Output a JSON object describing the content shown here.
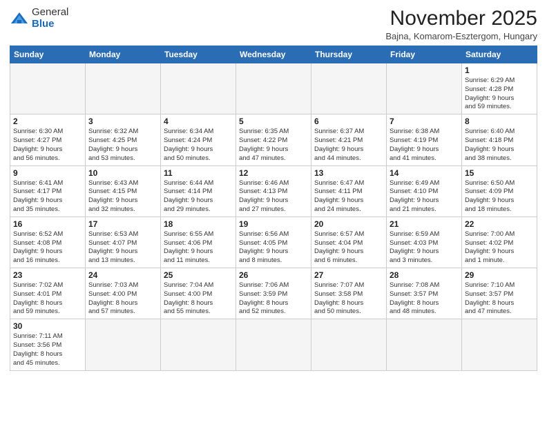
{
  "logo": {
    "general": "General",
    "blue": "Blue"
  },
  "header": {
    "month_title": "November 2025",
    "subtitle": "Bajna, Komarom-Esztergom, Hungary"
  },
  "weekdays": [
    "Sunday",
    "Monday",
    "Tuesday",
    "Wednesday",
    "Thursday",
    "Friday",
    "Saturday"
  ],
  "weeks": [
    [
      {
        "day": "",
        "info": ""
      },
      {
        "day": "",
        "info": ""
      },
      {
        "day": "",
        "info": ""
      },
      {
        "day": "",
        "info": ""
      },
      {
        "day": "",
        "info": ""
      },
      {
        "day": "",
        "info": ""
      },
      {
        "day": "1",
        "info": "Sunrise: 6:29 AM\nSunset: 4:28 PM\nDaylight: 9 hours\nand 59 minutes."
      }
    ],
    [
      {
        "day": "2",
        "info": "Sunrise: 6:30 AM\nSunset: 4:27 PM\nDaylight: 9 hours\nand 56 minutes."
      },
      {
        "day": "3",
        "info": "Sunrise: 6:32 AM\nSunset: 4:25 PM\nDaylight: 9 hours\nand 53 minutes."
      },
      {
        "day": "4",
        "info": "Sunrise: 6:34 AM\nSunset: 4:24 PM\nDaylight: 9 hours\nand 50 minutes."
      },
      {
        "day": "5",
        "info": "Sunrise: 6:35 AM\nSunset: 4:22 PM\nDaylight: 9 hours\nand 47 minutes."
      },
      {
        "day": "6",
        "info": "Sunrise: 6:37 AM\nSunset: 4:21 PM\nDaylight: 9 hours\nand 44 minutes."
      },
      {
        "day": "7",
        "info": "Sunrise: 6:38 AM\nSunset: 4:19 PM\nDaylight: 9 hours\nand 41 minutes."
      },
      {
        "day": "8",
        "info": "Sunrise: 6:40 AM\nSunset: 4:18 PM\nDaylight: 9 hours\nand 38 minutes."
      }
    ],
    [
      {
        "day": "9",
        "info": "Sunrise: 6:41 AM\nSunset: 4:17 PM\nDaylight: 9 hours\nand 35 minutes."
      },
      {
        "day": "10",
        "info": "Sunrise: 6:43 AM\nSunset: 4:15 PM\nDaylight: 9 hours\nand 32 minutes."
      },
      {
        "day": "11",
        "info": "Sunrise: 6:44 AM\nSunset: 4:14 PM\nDaylight: 9 hours\nand 29 minutes."
      },
      {
        "day": "12",
        "info": "Sunrise: 6:46 AM\nSunset: 4:13 PM\nDaylight: 9 hours\nand 27 minutes."
      },
      {
        "day": "13",
        "info": "Sunrise: 6:47 AM\nSunset: 4:11 PM\nDaylight: 9 hours\nand 24 minutes."
      },
      {
        "day": "14",
        "info": "Sunrise: 6:49 AM\nSunset: 4:10 PM\nDaylight: 9 hours\nand 21 minutes."
      },
      {
        "day": "15",
        "info": "Sunrise: 6:50 AM\nSunset: 4:09 PM\nDaylight: 9 hours\nand 18 minutes."
      }
    ],
    [
      {
        "day": "16",
        "info": "Sunrise: 6:52 AM\nSunset: 4:08 PM\nDaylight: 9 hours\nand 16 minutes."
      },
      {
        "day": "17",
        "info": "Sunrise: 6:53 AM\nSunset: 4:07 PM\nDaylight: 9 hours\nand 13 minutes."
      },
      {
        "day": "18",
        "info": "Sunrise: 6:55 AM\nSunset: 4:06 PM\nDaylight: 9 hours\nand 11 minutes."
      },
      {
        "day": "19",
        "info": "Sunrise: 6:56 AM\nSunset: 4:05 PM\nDaylight: 9 hours\nand 8 minutes."
      },
      {
        "day": "20",
        "info": "Sunrise: 6:57 AM\nSunset: 4:04 PM\nDaylight: 9 hours\nand 6 minutes."
      },
      {
        "day": "21",
        "info": "Sunrise: 6:59 AM\nSunset: 4:03 PM\nDaylight: 9 hours\nand 3 minutes."
      },
      {
        "day": "22",
        "info": "Sunrise: 7:00 AM\nSunset: 4:02 PM\nDaylight: 9 hours\nand 1 minute."
      }
    ],
    [
      {
        "day": "23",
        "info": "Sunrise: 7:02 AM\nSunset: 4:01 PM\nDaylight: 8 hours\nand 59 minutes."
      },
      {
        "day": "24",
        "info": "Sunrise: 7:03 AM\nSunset: 4:00 PM\nDaylight: 8 hours\nand 57 minutes."
      },
      {
        "day": "25",
        "info": "Sunrise: 7:04 AM\nSunset: 4:00 PM\nDaylight: 8 hours\nand 55 minutes."
      },
      {
        "day": "26",
        "info": "Sunrise: 7:06 AM\nSunset: 3:59 PM\nDaylight: 8 hours\nand 52 minutes."
      },
      {
        "day": "27",
        "info": "Sunrise: 7:07 AM\nSunset: 3:58 PM\nDaylight: 8 hours\nand 50 minutes."
      },
      {
        "day": "28",
        "info": "Sunrise: 7:08 AM\nSunset: 3:57 PM\nDaylight: 8 hours\nand 48 minutes."
      },
      {
        "day": "29",
        "info": "Sunrise: 7:10 AM\nSunset: 3:57 PM\nDaylight: 8 hours\nand 47 minutes."
      }
    ],
    [
      {
        "day": "30",
        "info": "Sunrise: 7:11 AM\nSunset: 3:56 PM\nDaylight: 8 hours\nand 45 minutes."
      },
      {
        "day": "",
        "info": ""
      },
      {
        "day": "",
        "info": ""
      },
      {
        "day": "",
        "info": ""
      },
      {
        "day": "",
        "info": ""
      },
      {
        "day": "",
        "info": ""
      },
      {
        "day": "",
        "info": ""
      }
    ]
  ]
}
